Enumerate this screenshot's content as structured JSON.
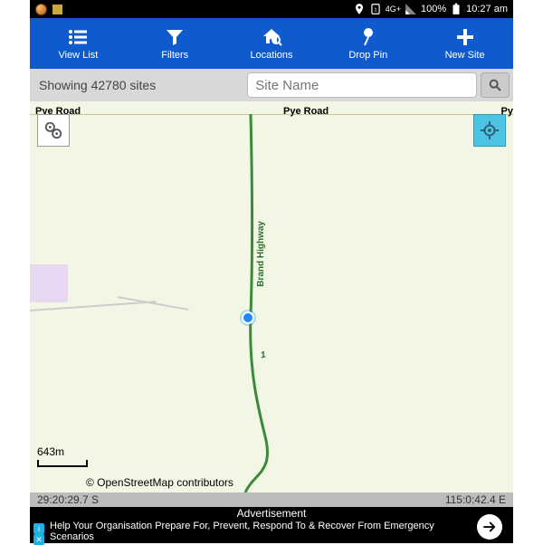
{
  "statusbar": {
    "network": "4G+",
    "battery_pct": "100%",
    "time": "10:27 am"
  },
  "toolbar": {
    "view_list": "View List",
    "filters": "Filters",
    "locations": "Locations",
    "drop_pin": "Drop Pin",
    "new_site": "New Site"
  },
  "filterrow": {
    "count_label": "Showing 42780 sites",
    "search_placeholder": "Site Name"
  },
  "map": {
    "road_name": "Pye Road",
    "road_name2": "Pye Road",
    "road_name3": "Py",
    "highway_name": "Brand Highway",
    "shield": "1",
    "scale_label": "643m",
    "attribution": "© OpenStreetMap contributors"
  },
  "coords": {
    "lat": "29:20:29.7 S",
    "lon": "115:0:42.4 E"
  },
  "ad": {
    "label": "Advertisement",
    "text": "Help Your Organisation Prepare For, Prevent, Respond To & Recover From Emergency Scenarios"
  }
}
